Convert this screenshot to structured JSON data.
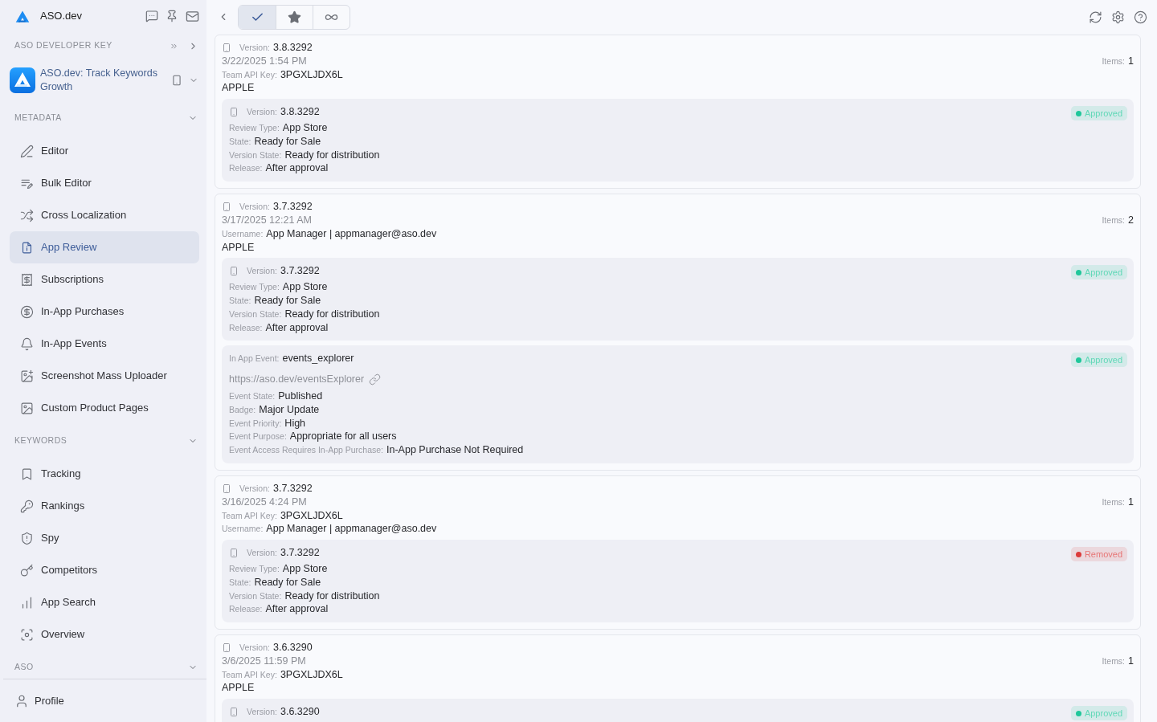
{
  "sidebar": {
    "brand": "ASO.dev",
    "developer_key": {
      "label": "ASO DEVELOPER KEY"
    },
    "app": {
      "name": "ASO.dev: Track Keywords Growth"
    },
    "sections": [
      {
        "title": "METADATA",
        "items": [
          {
            "label": "Editor",
            "selected": false
          },
          {
            "label": "Bulk Editor",
            "selected": false
          },
          {
            "label": "Cross Localization",
            "selected": false
          },
          {
            "label": "App Review",
            "selected": true
          },
          {
            "label": "Subscriptions",
            "selected": false
          },
          {
            "label": "In-App Purchases",
            "selected": false
          },
          {
            "label": "In-App Events",
            "selected": false
          },
          {
            "label": "Screenshot Mass Uploader",
            "selected": false
          },
          {
            "label": "Custom Product Pages",
            "selected": false
          }
        ]
      },
      {
        "title": "KEYWORDS",
        "items": [
          {
            "label": "Tracking",
            "selected": false
          },
          {
            "label": "Rankings",
            "selected": false
          },
          {
            "label": "Spy",
            "selected": false
          },
          {
            "label": "Competitors",
            "selected": false
          },
          {
            "label": "App Search",
            "selected": false
          },
          {
            "label": "Overview",
            "selected": false
          }
        ]
      },
      {
        "title": "ASO"
      }
    ],
    "profile": {
      "label": "Profile"
    }
  },
  "toolbar": {
    "filters": [
      {
        "selected": true
      },
      {
        "selected": false
      },
      {
        "selected": false
      }
    ]
  },
  "reviews": [
    {
      "version_label": "Version:",
      "version": "3.8.3292",
      "date": "3/22/2025 1:54 PM",
      "fields": [
        {
          "label": "Team API Key:",
          "value": "3PGXLJDX6L"
        }
      ],
      "platform": "APPLE",
      "items_label": "Items:",
      "items_count": "1",
      "entries": [
        {
          "kind": "version",
          "status": {
            "label": "Approved",
            "color": "#1fc79a"
          },
          "version_label": "Version:",
          "version": "3.8.3292",
          "fields": [
            {
              "label": "Review Type:",
              "value": "App Store"
            },
            {
              "label": "State:",
              "value": "Ready for Sale"
            },
            {
              "label": "Version State:",
              "value": "Ready for distribution"
            },
            {
              "label": "Release:",
              "value": "After approval"
            }
          ]
        }
      ]
    },
    {
      "version_label": "Version:",
      "version": "3.7.3292",
      "date": "3/17/2025 12:21 AM",
      "fields": [
        {
          "label": "Username:",
          "value": "App Manager | appmanager@aso.dev"
        }
      ],
      "platform": "APPLE",
      "items_label": "Items:",
      "items_count": "2",
      "entries": [
        {
          "kind": "version",
          "status": {
            "label": "Approved",
            "color": "#1fc79a"
          },
          "version_label": "Version:",
          "version": "3.7.3292",
          "fields": [
            {
              "label": "Review Type:",
              "value": "App Store"
            },
            {
              "label": "State:",
              "value": "Ready for Sale"
            },
            {
              "label": "Version State:",
              "value": "Ready for distribution"
            },
            {
              "label": "Release:",
              "value": "After approval"
            }
          ]
        },
        {
          "kind": "event",
          "status": {
            "label": "Approved",
            "color": "#1fc79a"
          },
          "title": {
            "label": "In App Event:",
            "value": "events_explorer"
          },
          "link": "https://aso.dev/eventsExplorer",
          "fields": [
            {
              "label": "Event State:",
              "value": "Published"
            },
            {
              "label": "Badge:",
              "value": "Major Update"
            },
            {
              "label": "Event Priority:",
              "value": "High"
            },
            {
              "label": "Event Purpose:",
              "value": "Appropriate for all users"
            },
            {
              "label": "Event Access Requires In-App Purchase:",
              "value": "In-App Purchase Not Required"
            }
          ]
        }
      ]
    },
    {
      "version_label": "Version:",
      "version": "3.7.3292",
      "date": "3/16/2025 4:24 PM",
      "fields": [
        {
          "label": "Team API Key:",
          "value": "3PGXLJDX6L"
        },
        {
          "label": "Username:",
          "value": "App Manager | appmanager@aso.dev"
        }
      ],
      "items_label": "Items:",
      "items_count": "1",
      "entries": [
        {
          "kind": "version",
          "status": {
            "label": "Removed",
            "color": "#dc3b3b"
          },
          "version_label": "Version:",
          "version": "3.7.3292",
          "fields": [
            {
              "label": "Review Type:",
              "value": "App Store"
            },
            {
              "label": "State:",
              "value": "Ready for Sale"
            },
            {
              "label": "Version State:",
              "value": "Ready for distribution"
            },
            {
              "label": "Release:",
              "value": "After approval"
            }
          ]
        }
      ]
    },
    {
      "version_label": "Version:",
      "version": "3.6.3290",
      "date": "3/6/2025 11:59 PM",
      "fields": [
        {
          "label": "Team API Key:",
          "value": "3PGXLJDX6L"
        }
      ],
      "platform": "APPLE",
      "items_label": "Items:",
      "items_count": "1",
      "entries": [
        {
          "kind": "version",
          "status": {
            "label": "Approved",
            "color": "#1fc79a"
          },
          "version_label": "Version:",
          "version": "3.6.3290"
        }
      ]
    }
  ]
}
